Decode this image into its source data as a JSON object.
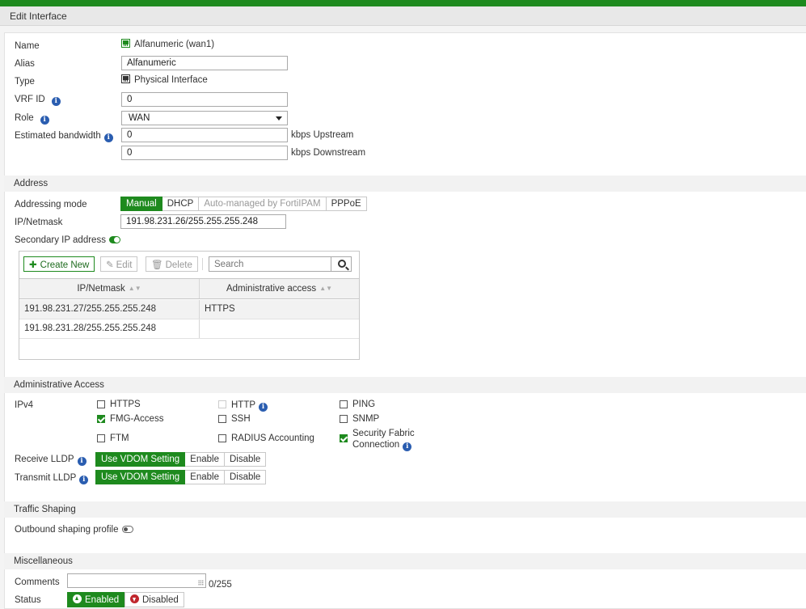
{
  "window_title": "Edit Interface",
  "general": {
    "name_label": "Name",
    "name_value": "Alfanumeric (wan1)",
    "alias_label": "Alias",
    "alias_value": "Alfanumeric",
    "type_label": "Type",
    "type_value": "Physical Interface",
    "vrf_label": "VRF ID",
    "vrf_value": "0",
    "role_label": "Role",
    "role_value": "WAN",
    "bandwidth_label": "Estimated bandwidth",
    "upstream_value": "0",
    "upstream_unit": "kbps Upstream",
    "downstream_value": "0",
    "downstream_unit": "kbps Downstream"
  },
  "address": {
    "section_title": "Address",
    "mode_label": "Addressing mode",
    "modes": [
      "Manual",
      "DHCP",
      "Auto-managed by FortiIPAM",
      "PPPoE"
    ],
    "active_mode": "Manual",
    "ip_label": "IP/Netmask",
    "ip_value": "191.98.231.26/255.255.255.248",
    "secondary_label": "Secondary IP address",
    "secondary_enabled": true,
    "toolbar": {
      "create_label": "Create New",
      "edit_label": "Edit",
      "delete_label": "Delete",
      "search_placeholder": "Search"
    },
    "columns": [
      "IP/Netmask",
      "Administrative access"
    ],
    "rows": [
      {
        "ip": "191.98.231.27/255.255.255.248",
        "access": "HTTPS"
      },
      {
        "ip": "191.98.231.28/255.255.255.248",
        "access": ""
      }
    ]
  },
  "admin_access": {
    "section_title": "Administrative Access",
    "ipv4_label": "IPv4",
    "options": {
      "https": {
        "label": "HTTPS",
        "checked": false
      },
      "http": {
        "label": "HTTP",
        "checked": false,
        "disabled": true
      },
      "ping": {
        "label": "PING",
        "checked": false
      },
      "fmg": {
        "label": "FMG-Access",
        "checked": true
      },
      "ssh": {
        "label": "SSH",
        "checked": false
      },
      "snmp": {
        "label": "SNMP",
        "checked": false
      },
      "ftm": {
        "label": "FTM",
        "checked": false
      },
      "radius": {
        "label": "RADIUS Accounting",
        "checked": false
      },
      "fabric_line1": "Security Fabric",
      "fabric_line2": "Connection",
      "fabric_checked": true
    },
    "receive_lldp_label": "Receive LLDP",
    "transmit_lldp_label": "Transmit LLDP",
    "lldp_options": [
      "Use VDOM Setting",
      "Enable",
      "Disable"
    ],
    "lldp_active": "Use VDOM Setting"
  },
  "traffic_shaping": {
    "section_title": "Traffic Shaping",
    "outbound_label": "Outbound shaping profile",
    "outbound_enabled": false
  },
  "misc": {
    "section_title": "Miscellaneous",
    "comments_label": "Comments",
    "comments_value": "",
    "comments_counter": "0/255",
    "status_label": "Status",
    "enabled_label": "Enabled",
    "disabled_label": "Disabled",
    "status_active": "Enabled"
  },
  "colors": {
    "accent": "#1e8a1e",
    "info": "#2a5db0",
    "danger": "#c0262d"
  }
}
